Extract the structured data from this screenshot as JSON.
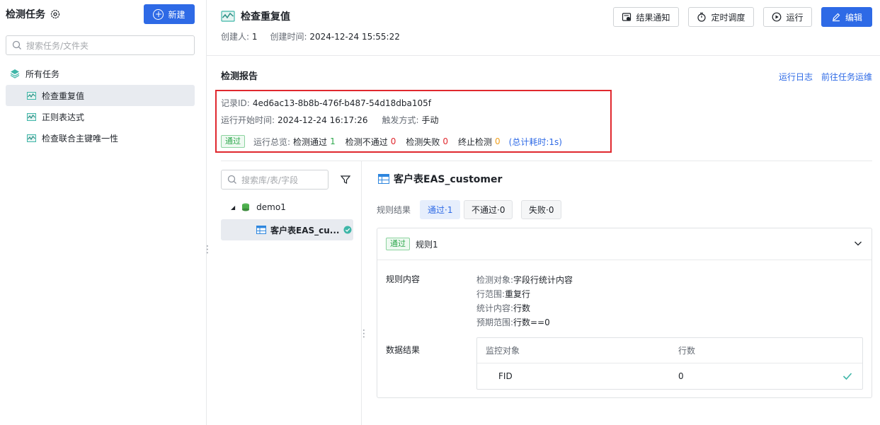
{
  "sidebar": {
    "title": "检测任务",
    "new_button": "新建",
    "search_placeholder": "搜索任务/文件夹",
    "root_label": "所有任务",
    "items": [
      {
        "label": "检查重复值",
        "active": true
      },
      {
        "label": "正则表达式",
        "active": false
      },
      {
        "label": "检查联合主键唯一性",
        "active": false
      }
    ]
  },
  "header": {
    "title": "检查重复值",
    "creator_label": "创建人:",
    "creator_value": "1",
    "created_label": "创建时间:",
    "created_value": "2024-12-24 15:55:22",
    "buttons": {
      "notify": "结果通知",
      "schedule": "定时调度",
      "run": "运行",
      "edit": "编辑"
    }
  },
  "report": {
    "title": "检测报告",
    "links": {
      "log": "运行日志",
      "ops": "前往任务运维"
    },
    "record_label": "记录ID:",
    "record_value": "4ed6ac13-8b8b-476f-b487-54d18dba105f",
    "start_label": "运行开始时间:",
    "start_value": "2024-12-24 16:17:26",
    "trigger_label": "触发方式:",
    "trigger_value": "手动",
    "status_badge": "通过",
    "overview_label": "运行总览:",
    "pass_label": "检测通过",
    "pass_count": "1",
    "fail_label": "检测不通过",
    "fail_count": "0",
    "error_label": "检测失败",
    "error_count": "0",
    "stop_label": "终止检测",
    "stop_count": "0",
    "total_time": "(总计耗时:1s)"
  },
  "tree": {
    "search_placeholder": "搜索库/表/字段",
    "db": "demo1",
    "table": "客户表EAS_cu..."
  },
  "detail": {
    "title": "客户表EAS_customer",
    "filter_label": "规则结果",
    "chips": {
      "pass": "通过·1",
      "fail": "不通过·0",
      "error": "失败·0"
    },
    "rule": {
      "badge": "通过",
      "name": "规则1",
      "content_label": "规则内容",
      "lines": [
        {
          "k": "检测对象:",
          "v": "字段行统计内容"
        },
        {
          "k": "行范围:",
          "v": "重复行"
        },
        {
          "k": "统计内容:",
          "v": "行数"
        },
        {
          "k": "预期范围:",
          "v": "行数==0"
        }
      ],
      "result_label": "数据结果",
      "table": {
        "headers": [
          "监控对象",
          "行数"
        ],
        "rows": [
          {
            "object": "FID",
            "count": "0"
          }
        ]
      }
    }
  },
  "colors": {
    "primary": "#2e6ae6",
    "pass": "#2ea84d",
    "fail": "#e0282e",
    "warn": "#f0a020"
  }
}
